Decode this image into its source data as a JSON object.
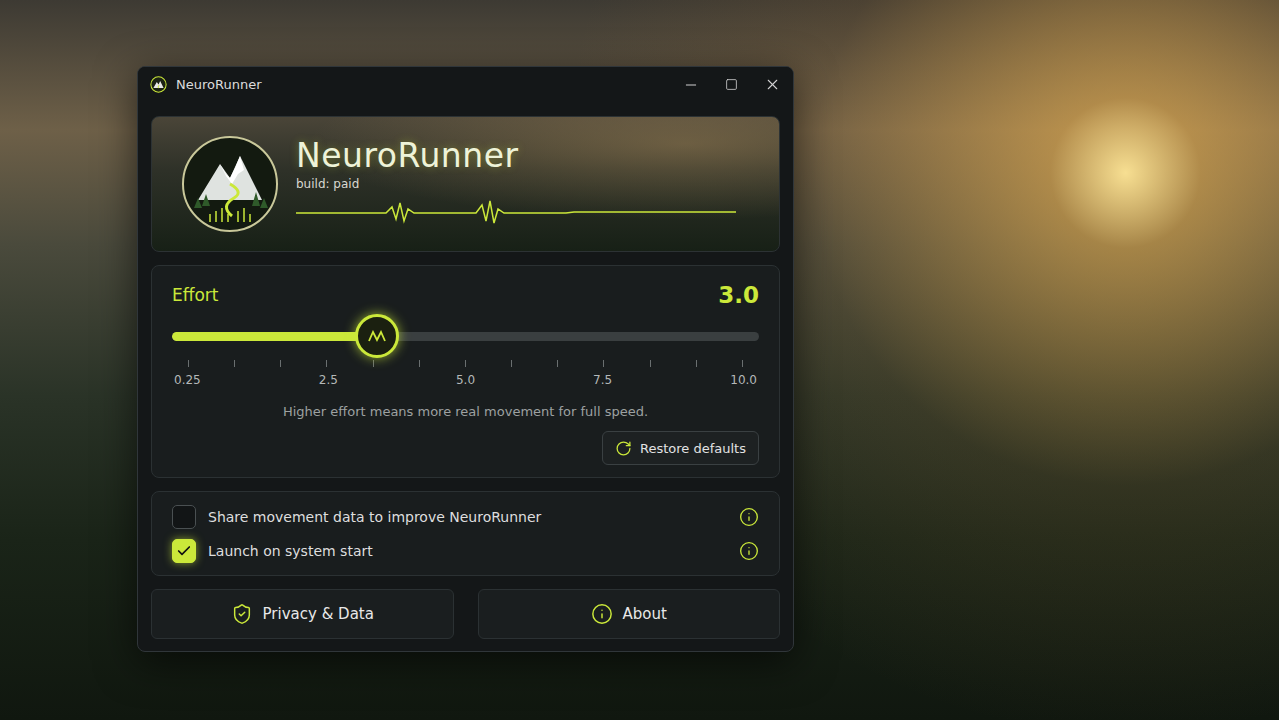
{
  "window": {
    "title": "NeuroRunner"
  },
  "banner": {
    "title": "NeuroRunner",
    "subtitle": "build: paid"
  },
  "effort": {
    "label": "Effort",
    "value": "3.0",
    "level": 0.35,
    "ticks": [
      "0.25",
      "2.5",
      "5.0",
      "7.5",
      "10.0"
    ],
    "hint": "Higher effort means more real movement for full speed.",
    "reset_button": "Restore defaults"
  },
  "options": [
    {
      "label": "Share movement data to improve NeuroRunner",
      "checked": false
    },
    {
      "label": "Launch on system start",
      "checked": true
    }
  ],
  "buttons": [
    {
      "label": "Privacy & Data"
    },
    {
      "label": "About"
    }
  ]
}
